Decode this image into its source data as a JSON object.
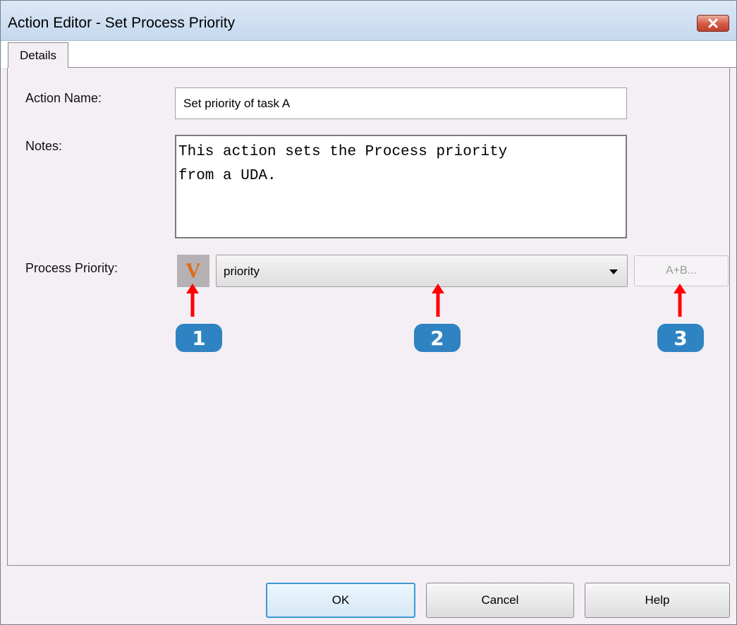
{
  "window": {
    "title": "Action Editor - Set Process Priority",
    "close_icon": "close-icon",
    "close_color": "#c9473a"
  },
  "tabs": [
    {
      "label": "Details",
      "active": true
    }
  ],
  "form": {
    "action_name_label": "Action Name:",
    "action_name_value": "Set priority of task A",
    "notes_label": "Notes:",
    "notes_value": "This action sets the Process priority\nfrom a UDA.",
    "priority_label": "Process Priority:",
    "variable_toggle_glyph": "V",
    "priority_value": "priority",
    "expression_button_label": "A+B..."
  },
  "callouts": [
    {
      "number": "1",
      "target": "variable-toggle"
    },
    {
      "number": "2",
      "target": "priority-dropdown"
    },
    {
      "number": "3",
      "target": "expression-button"
    }
  ],
  "buttons": {
    "ok": "OK",
    "cancel": "Cancel",
    "help": "Help"
  },
  "colors": {
    "accent": "#2f83c2",
    "arrow": "#ff0000",
    "variable_glyph": "#e06a12"
  }
}
